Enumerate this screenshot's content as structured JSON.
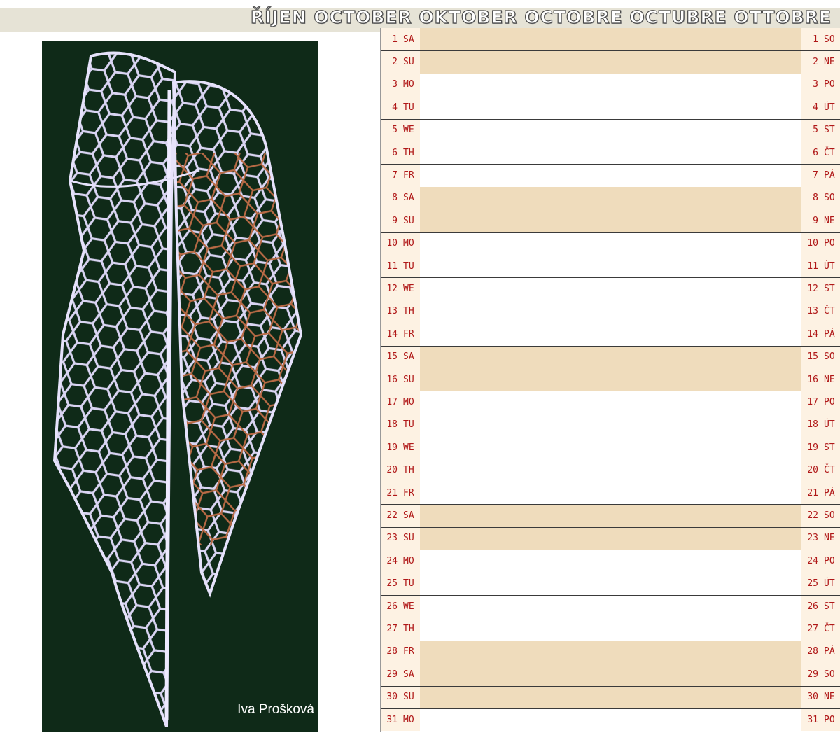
{
  "header": {
    "title": "ŘÍJEN OCTOBER OKTOBER OCTOBRE OCTUBRE OTTOBRE"
  },
  "photo": {
    "credit": "Iva Prošková"
  },
  "days": [
    {
      "num": "1",
      "en": "SA",
      "cz": "SO",
      "weekend": true
    },
    {
      "num": "2",
      "en": "SU",
      "cz": "NE",
      "weekend": true
    },
    {
      "num": "3",
      "en": "MO",
      "cz": "PO",
      "weekend": false
    },
    {
      "num": "4",
      "en": "TU",
      "cz": "ÚT",
      "weekend": false
    },
    {
      "num": "5",
      "en": "WE",
      "cz": "ST",
      "weekend": false
    },
    {
      "num": "6",
      "en": "TH",
      "cz": "ČT",
      "weekend": false
    },
    {
      "num": "7",
      "en": "FR",
      "cz": "PÁ",
      "weekend": false
    },
    {
      "num": "8",
      "en": "SA",
      "cz": "SO",
      "weekend": true
    },
    {
      "num": "9",
      "en": "SU",
      "cz": "NE",
      "weekend": true
    },
    {
      "num": "10",
      "en": "MO",
      "cz": "PO",
      "weekend": false
    },
    {
      "num": "11",
      "en": "TU",
      "cz": "ÚT",
      "weekend": false
    },
    {
      "num": "12",
      "en": "WE",
      "cz": "ST",
      "weekend": false
    },
    {
      "num": "13",
      "en": "TH",
      "cz": "ČT",
      "weekend": false
    },
    {
      "num": "14",
      "en": "FR",
      "cz": "PÁ",
      "weekend": false
    },
    {
      "num": "15",
      "en": "SA",
      "cz": "SO",
      "weekend": true
    },
    {
      "num": "16",
      "en": "SU",
      "cz": "NE",
      "weekend": true
    },
    {
      "num": "17",
      "en": "MO",
      "cz": "PO",
      "weekend": false
    },
    {
      "num": "18",
      "en": "TU",
      "cz": "ÚT",
      "weekend": false
    },
    {
      "num": "19",
      "en": "WE",
      "cz": "ST",
      "weekend": false
    },
    {
      "num": "20",
      "en": "TH",
      "cz": "ČT",
      "weekend": false
    },
    {
      "num": "21",
      "en": "FR",
      "cz": "PÁ",
      "weekend": false
    },
    {
      "num": "22",
      "en": "SA",
      "cz": "SO",
      "weekend": true
    },
    {
      "num": "23",
      "en": "SU",
      "cz": "NE",
      "weekend": true
    },
    {
      "num": "24",
      "en": "MO",
      "cz": "PO",
      "weekend": false
    },
    {
      "num": "25",
      "en": "TU",
      "cz": "ÚT",
      "weekend": false
    },
    {
      "num": "26",
      "en": "WE",
      "cz": "ST",
      "weekend": false
    },
    {
      "num": "27",
      "en": "TH",
      "cz": "ČT",
      "weekend": false
    },
    {
      "num": "28",
      "en": "FR",
      "cz": "PÁ",
      "weekend": true
    },
    {
      "num": "29",
      "en": "SA",
      "cz": "SO",
      "weekend": true
    },
    {
      "num": "30",
      "en": "SU",
      "cz": "NE",
      "weekend": true
    },
    {
      "num": "31",
      "en": "MO",
      "cz": "PO",
      "weekend": false
    }
  ]
}
